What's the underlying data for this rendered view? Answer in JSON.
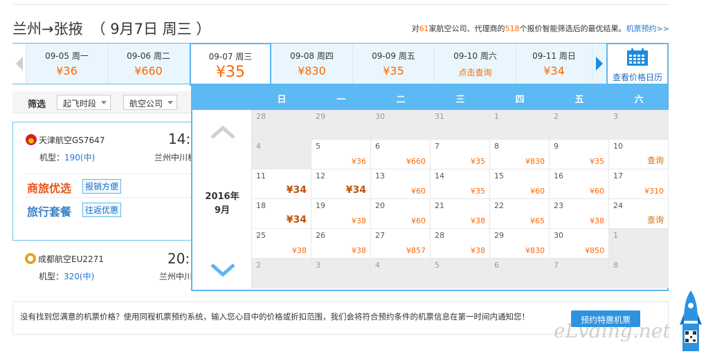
{
  "header": {
    "route": "兰州→张掖",
    "date": "（ 9月7日 周三 ）",
    "summary_pre": "对",
    "airline_count": "61",
    "summary_mid": "家航空公司、代理商的",
    "quote_count": "518",
    "summary_post": "个报价智能筛选后的最优结果。",
    "booking_link": "机票预约>>"
  },
  "date_strip": {
    "days": [
      {
        "date": "09-05 周一",
        "price": "¥36"
      },
      {
        "date": "09-06 周二",
        "price": "¥660"
      },
      {
        "date": "09-07 周三",
        "price": "¥35"
      },
      {
        "date": "09-08 周四",
        "price": "¥830"
      },
      {
        "date": "09-09 周五",
        "price": "¥35"
      },
      {
        "date": "09-10 周六",
        "price": "点击查询"
      },
      {
        "date": "09-11 周日",
        "price": "¥34"
      }
    ],
    "calendar_button": "查看价格日历"
  },
  "filter": {
    "label": "筛选",
    "departure_time": "起飞时段",
    "airline": "航空公司"
  },
  "flights": [
    {
      "airline": "天津航空GS7647",
      "time": "14:",
      "model_label": "机型：",
      "model": "190(中)",
      "airport": "兰州中川机"
    },
    {
      "airline": "成都航空EU2271",
      "time": "20:",
      "model_label": "机型：",
      "model": "320(中)",
      "airport": "兰州中川"
    }
  ],
  "promos": [
    {
      "logo": "商旅优选",
      "tag": "报销方便"
    },
    {
      "logo": "旅行套餐",
      "tag": "往返优惠"
    }
  ],
  "calendar": {
    "weekdays": [
      "日",
      "一",
      "二",
      "三",
      "四",
      "五",
      "六"
    ],
    "year": "2016年",
    "month": "9月",
    "rows": [
      [
        {
          "d": "28",
          "p": "",
          "o": true
        },
        {
          "d": "29",
          "p": "",
          "o": true
        },
        {
          "d": "30",
          "p": "",
          "o": true
        },
        {
          "d": "31",
          "p": "",
          "o": true
        },
        {
          "d": "1",
          "p": "",
          "o": true
        },
        {
          "d": "2",
          "p": "",
          "o": true
        },
        {
          "d": "3",
          "p": "",
          "o": true
        }
      ],
      [
        {
          "d": "4",
          "p": "",
          "o": true
        },
        {
          "d": "5",
          "p": "¥36"
        },
        {
          "d": "6",
          "p": "¥660"
        },
        {
          "d": "7",
          "p": "¥35"
        },
        {
          "d": "8",
          "p": "¥830"
        },
        {
          "d": "9",
          "p": "¥35"
        },
        {
          "d": "10",
          "p": "查询",
          "q": true
        }
      ],
      [
        {
          "d": "11",
          "p": "¥34",
          "low": true
        },
        {
          "d": "12",
          "p": "¥34",
          "low": true
        },
        {
          "d": "13",
          "p": "¥60"
        },
        {
          "d": "14",
          "p": "¥35"
        },
        {
          "d": "15",
          "p": "¥60"
        },
        {
          "d": "16",
          "p": "¥60"
        },
        {
          "d": "17",
          "p": "¥310"
        }
      ],
      [
        {
          "d": "18",
          "p": "¥34",
          "low": true
        },
        {
          "d": "19",
          "p": "¥38"
        },
        {
          "d": "20",
          "p": "¥60"
        },
        {
          "d": "21",
          "p": "¥38"
        },
        {
          "d": "22",
          "p": "¥65"
        },
        {
          "d": "23",
          "p": "¥38"
        },
        {
          "d": "24",
          "p": "查询",
          "q": true
        }
      ],
      [
        {
          "d": "25",
          "p": "¥38"
        },
        {
          "d": "26",
          "p": "¥38"
        },
        {
          "d": "27",
          "p": "¥857"
        },
        {
          "d": "28",
          "p": "¥38"
        },
        {
          "d": "29",
          "p": "¥830"
        },
        {
          "d": "30",
          "p": "¥850"
        },
        {
          "d": "1",
          "p": "",
          "o": true
        }
      ],
      [
        {
          "d": "2",
          "p": "",
          "o": true
        },
        {
          "d": "3",
          "p": "",
          "o": true
        },
        {
          "d": "4",
          "p": "",
          "o": true
        },
        {
          "d": "5",
          "p": "",
          "o": true
        },
        {
          "d": "6",
          "p": "",
          "o": true
        },
        {
          "d": "7",
          "p": "",
          "o": true
        },
        {
          "d": "8",
          "p": "",
          "o": true
        }
      ]
    ]
  },
  "notice": {
    "text": "没有找到您满意的机票价格？使用同程机票预约系统，输入您心目中的价格或折扣范围，我们会将符合预约条件的机票信息在第一时间内通知您！",
    "button": "预约特惠机票"
  },
  "watermark": "eLvding.net",
  "colors": {
    "accent": "#5ab7f0",
    "price": "#ff6600",
    "link": "#2277cc"
  }
}
